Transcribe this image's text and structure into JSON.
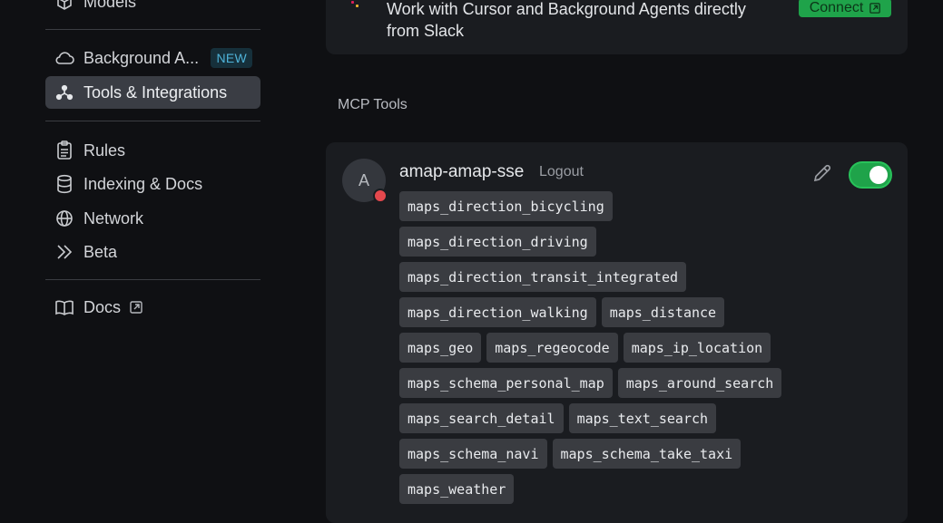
{
  "sidebar": {
    "items": [
      {
        "label": "Models",
        "icon": "cube-icon"
      },
      {
        "label": "Background A...",
        "icon": "cloud-icon",
        "badge": "NEW"
      },
      {
        "label": "Tools & Integrations",
        "icon": "nodes-icon",
        "active": true
      },
      {
        "label": "Rules",
        "icon": "clipboard-icon"
      },
      {
        "label": "Indexing & Docs",
        "icon": "database-icon"
      },
      {
        "label": "Network",
        "icon": "globe-icon"
      },
      {
        "label": "Beta",
        "icon": "double-chevron-icon"
      },
      {
        "label": "Docs",
        "icon": "book-icon"
      }
    ]
  },
  "slack": {
    "text": "Work with Cursor and Background Agents directly from Slack",
    "connect_label": "Connect"
  },
  "mcp": {
    "section_title": "MCP Tools",
    "server": {
      "avatar_letter": "A",
      "name": "amap-amap-sse",
      "logout_label": "Logout",
      "enabled": true,
      "status_color": "#e5484d"
    },
    "tool_rows": [
      [
        "maps_direction_bicycling"
      ],
      [
        "maps_direction_driving"
      ],
      [
        "maps_direction_transit_integrated"
      ],
      [
        "maps_direction_walking",
        "maps_distance"
      ],
      [
        "maps_geo",
        "maps_regeocode",
        "maps_ip_location"
      ],
      [
        "maps_schema_personal_map",
        "maps_around_search"
      ],
      [
        "maps_search_detail",
        "maps_text_search"
      ],
      [
        "maps_schema_navi",
        "maps_schema_take_taxi"
      ],
      [
        "maps_weather"
      ]
    ]
  },
  "colors": {
    "background": "#0f1013",
    "card": "#1a1c20",
    "active_item": "#3a3d44",
    "accent_green": "#1fa34a",
    "badge_text": "#4fb3d9"
  }
}
